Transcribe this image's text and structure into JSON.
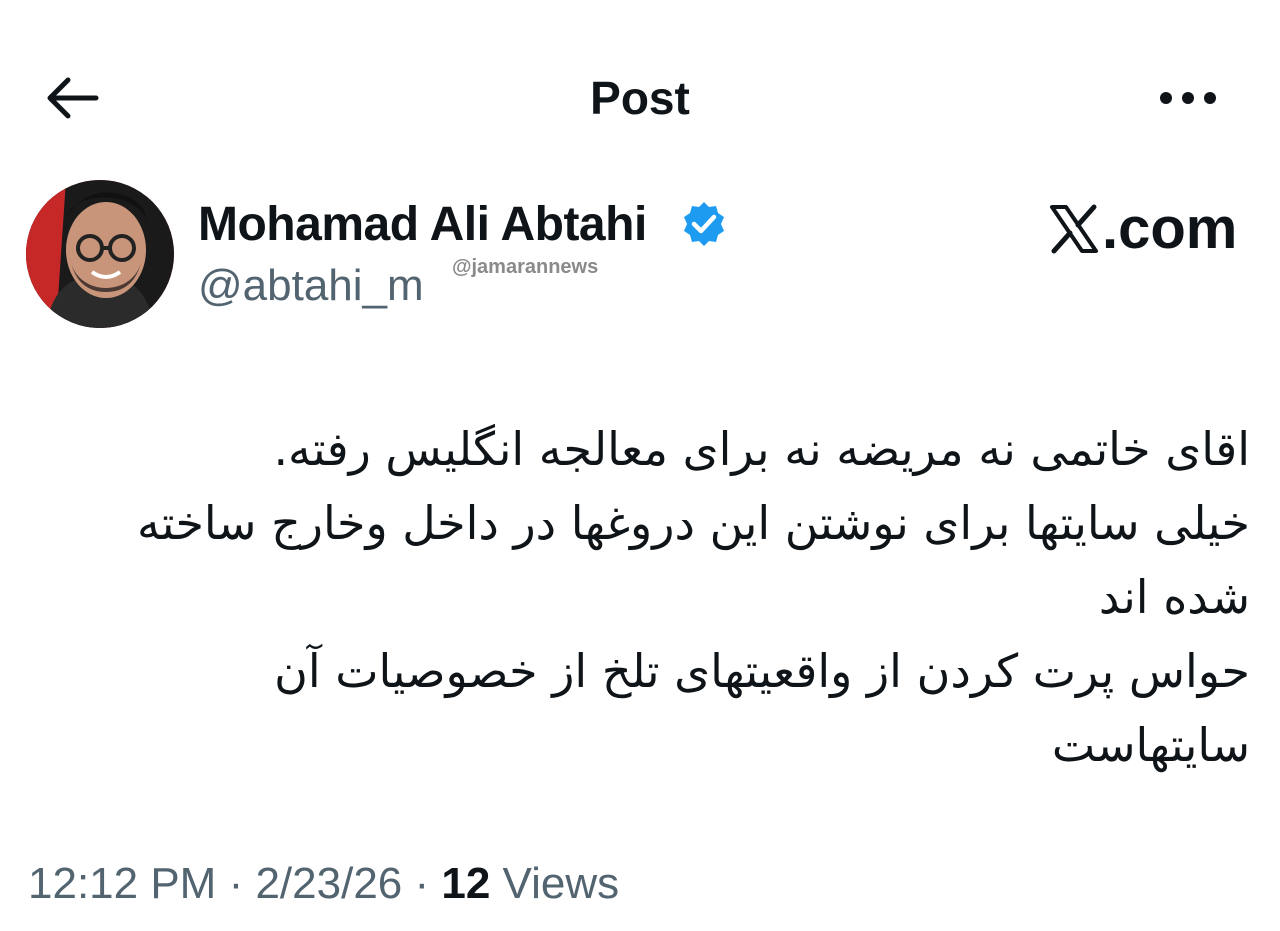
{
  "header": {
    "title": "Post",
    "back_icon": "arrow-left-icon",
    "more_icon": "more-horizontal-icon"
  },
  "author": {
    "name": "Mohamad Ali Abtahi",
    "handle": "@abtahi_m",
    "verified": true,
    "verified_color": "#1d9bf0"
  },
  "watermark": "@jamarannews",
  "site_label": ".com",
  "post": {
    "lines": [
      "اقای خاتمی نه مریضه نه برای معالجه انگلیس رفته.",
      "خیلی سایتها برای نوشتن این دروغها در داخل وخارج ساخته",
      "شده اند",
      "حواس پرت کردن از واقعیتهای تلخ از خصوصیات آن",
      "سایتهاست"
    ]
  },
  "meta": {
    "time": "12:12 PM",
    "sep1": " · ",
    "date": "2/23/26",
    "sep2": " · ",
    "views_count": "12",
    "views_label": " Views"
  },
  "colors": {
    "text": "#0f1419",
    "secondary": "#536471",
    "avatar_bg": "#c62828"
  }
}
